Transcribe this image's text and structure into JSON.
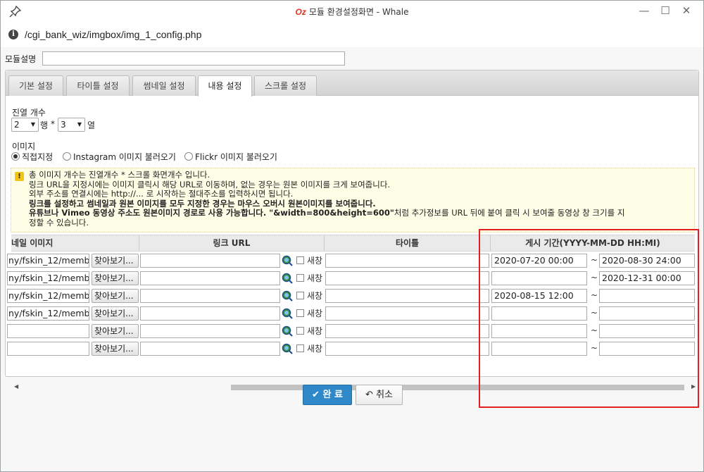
{
  "window": {
    "title_logo": "Oz",
    "title": "모듈 환경설정화면 - Whale",
    "url": "/cgi_bank_wiz/imgbox/img_1_config.php"
  },
  "form": {
    "module_desc_label": "모듈설명",
    "module_desc_value": ""
  },
  "tabs": [
    {
      "label": "기본 설정",
      "active": false
    },
    {
      "label": "타이틀 설정",
      "active": false
    },
    {
      "label": "썸네일 설정",
      "active": false
    },
    {
      "label": "내용 설정",
      "active": true
    },
    {
      "label": "스크롤 설정",
      "active": false
    }
  ],
  "layout_section": {
    "label": "진열 개수",
    "rows_value": "2",
    "rows_unit": "행",
    "times": "*",
    "cols_value": "3",
    "cols_unit": "열"
  },
  "image_section": {
    "label": "이미지",
    "options": [
      {
        "label": "직접지정",
        "checked": true
      },
      {
        "label": "Instagram 이미지 불러오기",
        "checked": false
      },
      {
        "label": "Flickr 이미지 불러오기",
        "checked": false
      }
    ]
  },
  "notice": {
    "line1": "총 이미지 개수는 진열개수 * 스크롤 화면개수 입니다.",
    "line2": "링크 URL을 지정시에는 이미지 클릭시 해당 URL로 이동하며, 없는 경우는 원본 이미지를 크게 보여줍니다.",
    "line3": "외부 주소를 연결시에는 http://... 로 시작하는 절대주소를 입력하시면 됩니다.",
    "line4": "링크를 설정하고 썸네일과 원본 이미지를 모두 지정한 경우는 마우스 오버시 원본이미지를 보여줍니다.",
    "line5_bold": "유튜브나 Vimeo 동영상 주소도 원본이미지 경로로 사용 가능합니다. \"&width=800&height=600\"",
    "line5_rest": "처럼 추가정보를 URL 뒤에 붙여 클릭 시 보여줄 동영상 창 크기를 지",
    "line6": "정할 수 있습니다."
  },
  "table": {
    "headers": {
      "thumbnail": "네일 이미지",
      "link_url": "링크 URL",
      "title": "타이틀",
      "period": "게시 기간(YYYY-MM-DD HH:MI)"
    },
    "browse_label": "찾아보기...",
    "new_window_label": "새창",
    "tilde": "~",
    "rows": [
      {
        "thumb": "ny/fskin_12/memb",
        "link": "",
        "title": "",
        "start": "2020-07-20 00:00",
        "end": "2020-08-30 24:00"
      },
      {
        "thumb": "ny/fskin_12/memb",
        "link": "",
        "title": "",
        "start": "",
        "end": "2020-12-31 00:00"
      },
      {
        "thumb": "ny/fskin_12/memb",
        "link": "",
        "title": "",
        "start": "2020-08-15 12:00",
        "end": ""
      },
      {
        "thumb": "ny/fskin_12/memb",
        "link": "",
        "title": "",
        "start": "",
        "end": ""
      },
      {
        "thumb": "",
        "link": "",
        "title": "",
        "start": "",
        "end": ""
      },
      {
        "thumb": "",
        "link": "",
        "title": "",
        "start": "",
        "end": ""
      }
    ]
  },
  "actions": {
    "ok_label": "완 료",
    "cancel_label": "취소"
  },
  "colors": {
    "ok_button": "#2f89c9",
    "highlight_box": "#e02020",
    "notice_bg": "#fefde5"
  }
}
